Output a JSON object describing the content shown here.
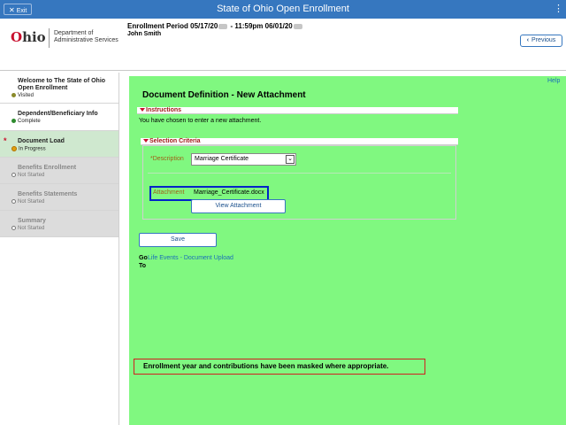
{
  "topbar": {
    "exit_label": "Exit",
    "title": "State of Ohio Open Enrollment",
    "menu_glyph": "⋮"
  },
  "header": {
    "logo_word": "Ohio",
    "logo_dept_line1": "Department of",
    "logo_dept_line2": "Administrative Services",
    "enrollment_label": "Enrollment Period 05/17/20",
    "enrollment_mid": " - 11:59pm 06/01/20",
    "user_name": "John Smith",
    "previous_label": "Previous"
  },
  "sidebar": {
    "steps": [
      {
        "line1": "Welcome to The State of Ohio",
        "line2": "Open Enrollment",
        "status": "Visited",
        "state": "visited"
      },
      {
        "line1": "Dependent/Beneficiary Info",
        "status": "Complete",
        "state": "complete"
      },
      {
        "line1": "Document Load",
        "status": "In Progress",
        "state": "in-progress",
        "marker": "*"
      },
      {
        "line1": "Benefits Enrollment",
        "status": "Not Started",
        "state": "not-started"
      },
      {
        "line1": "Benefits Statements",
        "status": "Not Started",
        "state": "not-started"
      },
      {
        "line1": "Summary",
        "status": "Not Started",
        "state": "not-started"
      }
    ]
  },
  "main": {
    "help_label": "Help",
    "page_title": "Document Definition - New Attachment",
    "instructions_heading": "Instructions",
    "instructions_text": "You have chosen to enter a new attachment.",
    "criteria_heading": "Selection Criteria",
    "description_label": "*Description",
    "description_value": "Marriage Certificate",
    "attachment_label": "Attachment",
    "attachment_file": "Marriage_Certificate.docx",
    "view_attachment_label": "View Attachment",
    "save_label": "Save",
    "goto_label_1": "Go",
    "goto_label_2": "To",
    "goto_link": "Life Events - Document Upload",
    "notice": "Enrollment year and contributions have been masked where appropriate."
  },
  "colors": {
    "topbar": "#3677bf",
    "panel_bg": "#80f880",
    "attachment_highlight": "#0024c8",
    "notice_border": "#d02020",
    "section_heading": "#a01818"
  }
}
